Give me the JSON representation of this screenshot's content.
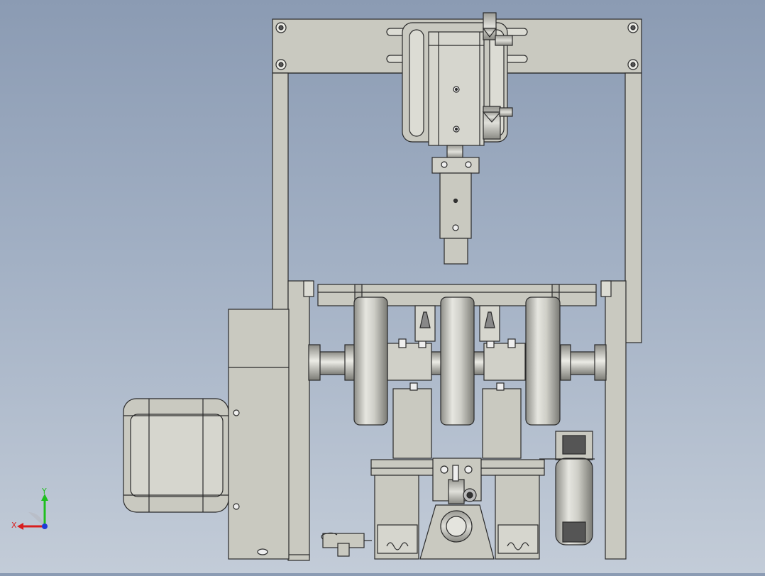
{
  "viewport": {
    "background_top": "#8b9bb3",
    "background_bottom": "#c3ccd8",
    "part_fill": "#c9c9c0",
    "part_fill_light": "#dcdcd4",
    "edge_color": "#2a2a2a"
  },
  "triad": {
    "x_label": "X",
    "y_label": "Y",
    "x_color": "#d81e1e",
    "y_color": "#1fbf1f",
    "z_color": "#1e3cd8"
  }
}
